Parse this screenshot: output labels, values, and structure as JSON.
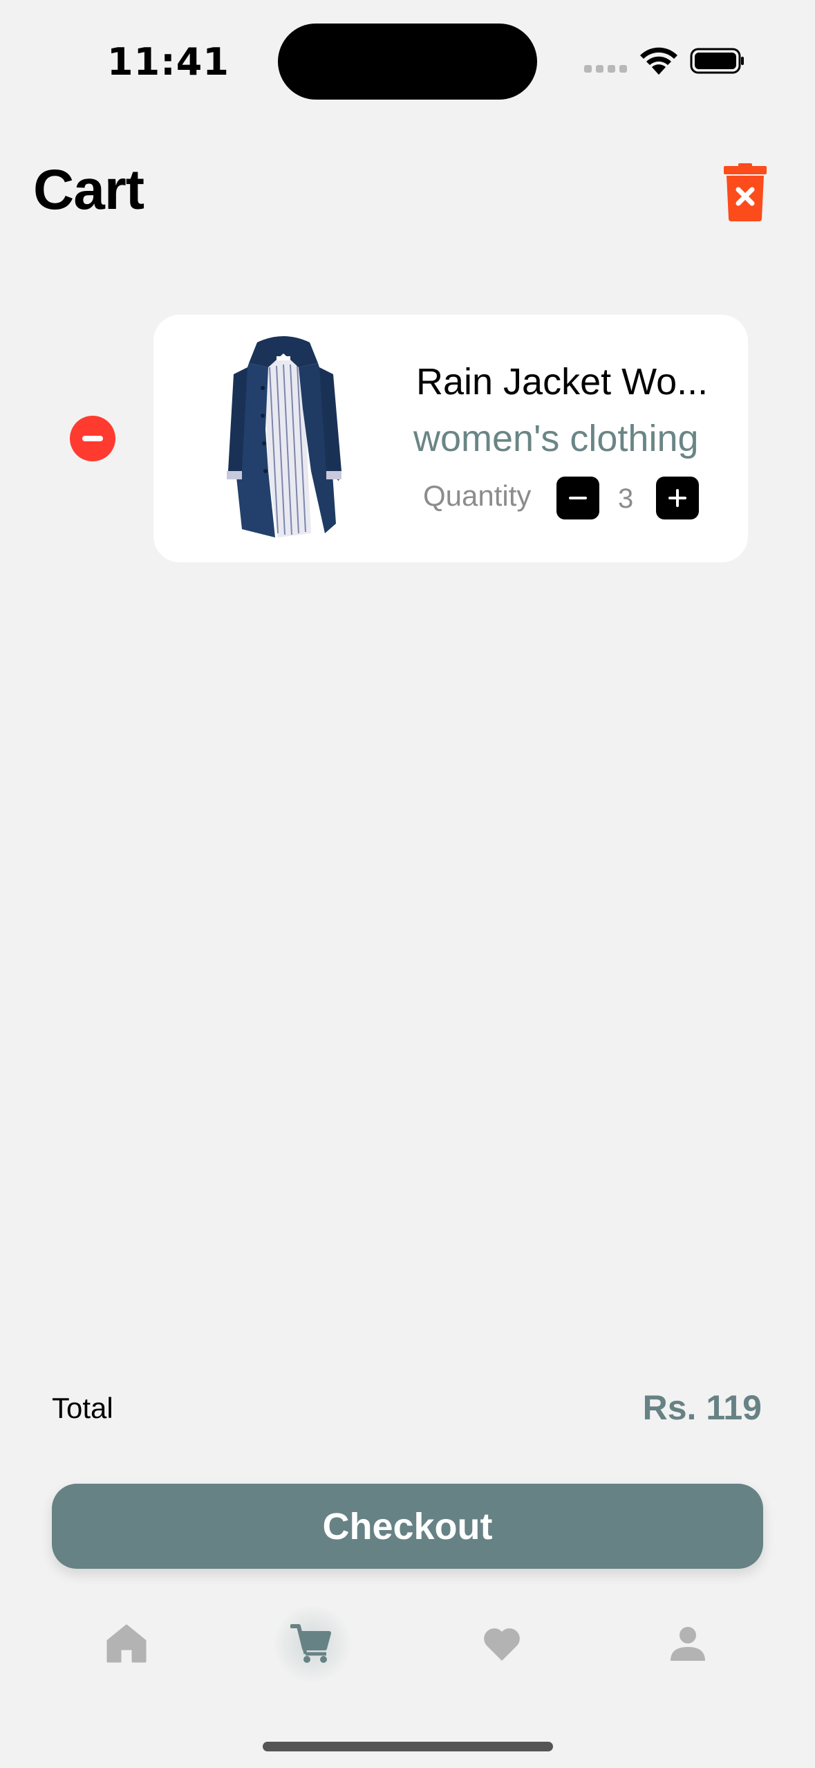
{
  "status_bar": {
    "time": "11:41"
  },
  "header": {
    "title": "Cart"
  },
  "cart": {
    "items": [
      {
        "name": "Rain Jacket Wo...",
        "category": "women's clothing",
        "quantity_label": "Quantity",
        "quantity": "3"
      }
    ]
  },
  "summary": {
    "total_label": "Total",
    "total_value": "Rs. 119"
  },
  "checkout": {
    "label": "Checkout"
  },
  "tab_bar": {
    "tabs": [
      "home-icon",
      "cart-icon",
      "heart-icon",
      "profile-icon"
    ],
    "active": "cart-icon"
  },
  "colors": {
    "accent": "#678284",
    "danger": "#ff3b30",
    "trash": "#fc4c1c",
    "background": "#f2f2f2",
    "inactive_icon": "#b3b3b3"
  }
}
